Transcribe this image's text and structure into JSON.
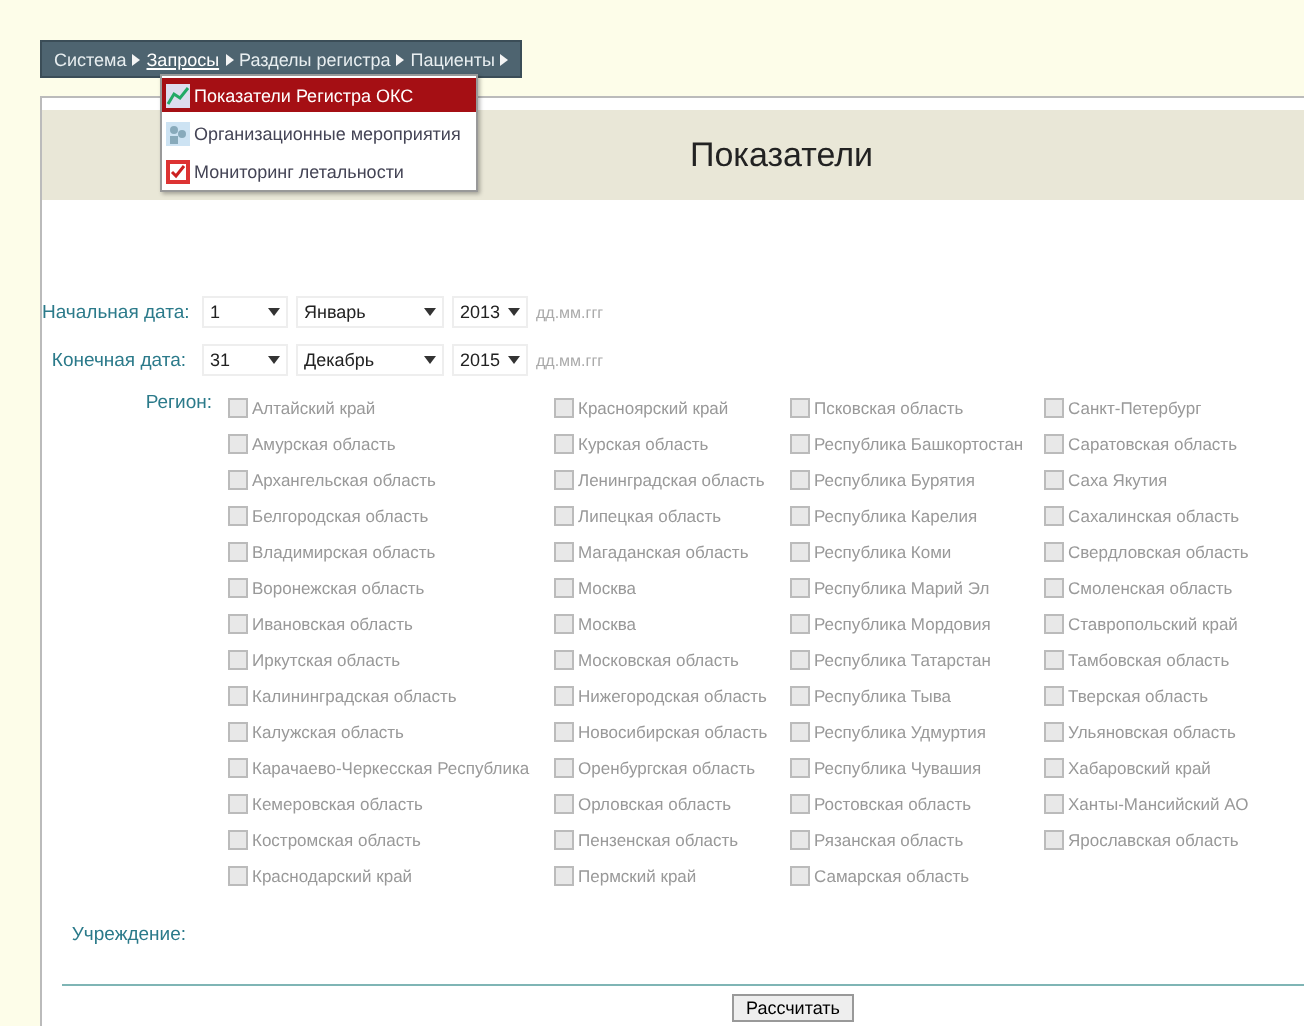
{
  "menu_bar": {
    "items": [
      {
        "label": "Система",
        "expanded": false
      },
      {
        "label": "Запросы",
        "expanded": true
      },
      {
        "label": "Разделы регистра",
        "expanded": false
      },
      {
        "label": "Пациенты",
        "expanded": false
      }
    ]
  },
  "dropdown": {
    "items": [
      {
        "label": "Показатели Регистра ОКС",
        "kind": "chart",
        "selected": true
      },
      {
        "label": "Организационные мероприятия",
        "kind": "people",
        "selected": false
      },
      {
        "label": "Мониторинг летальности",
        "kind": "checklist",
        "selected": false
      }
    ]
  },
  "page_title": "Показатели",
  "dates": [
    {
      "label": "Начальная дата:",
      "day": "1",
      "month": "Январь",
      "year": "2013",
      "hint": "дд.мм.ггг"
    },
    {
      "label": "Конечная дата:",
      "day": "31",
      "month": "Декабрь",
      "year": "2015",
      "hint": "дд.мм.ггг"
    }
  ],
  "region": {
    "label": "Регион:",
    "options": [
      {
        "label": "Алтайский край",
        "checked": false
      },
      {
        "label": "Амурская область",
        "checked": false
      },
      {
        "label": "Архангельская область",
        "checked": false
      },
      {
        "label": "Белгородская область",
        "checked": false
      },
      {
        "label": "Владимирская область",
        "checked": false
      },
      {
        "label": "Воронежская область",
        "checked": false
      },
      {
        "label": "Ивановская область",
        "checked": false
      },
      {
        "label": "Иркутская область",
        "checked": false
      },
      {
        "label": "Калининградская область",
        "checked": false
      },
      {
        "label": "Калужская область",
        "checked": false
      },
      {
        "label": "Карачаево-Черкесская Республика",
        "checked": false
      },
      {
        "label": "Кемеровская область",
        "checked": false
      },
      {
        "label": "Костромская область",
        "checked": false
      },
      {
        "label": "Краснодарский край",
        "checked": false
      },
      {
        "label": "Красноярский край",
        "checked": false
      },
      {
        "label": "Курская область",
        "checked": false
      },
      {
        "label": "Ленинградская область",
        "checked": false
      },
      {
        "label": "Липецкая область",
        "checked": false
      },
      {
        "label": "Магаданская область",
        "checked": false
      },
      {
        "label": "Москва",
        "checked": false
      },
      {
        "label": "Москва",
        "checked": false
      },
      {
        "label": "Московская область",
        "checked": false
      },
      {
        "label": "Нижегородская область",
        "checked": false
      },
      {
        "label": "Новосибирская область",
        "checked": false
      },
      {
        "label": "Оренбургская область",
        "checked": false
      },
      {
        "label": "Орловская область",
        "checked": false
      },
      {
        "label": "Пензенская область",
        "checked": false
      },
      {
        "label": "Пермский край",
        "checked": false
      },
      {
        "label": "Псковская область",
        "checked": false
      },
      {
        "label": "Республика Башкортостан",
        "checked": false
      },
      {
        "label": "Республика Бурятия",
        "checked": false
      },
      {
        "label": "Республика Карелия",
        "checked": false
      },
      {
        "label": "Республика Коми",
        "checked": false
      },
      {
        "label": "Республика Марий Эл",
        "checked": false
      },
      {
        "label": "Республика Мордовия",
        "checked": false
      },
      {
        "label": "Республика Татарстан",
        "checked": false
      },
      {
        "label": "Республика Тыва",
        "checked": false
      },
      {
        "label": "Республика Удмуртия",
        "checked": false
      },
      {
        "label": "Республика Чувашия",
        "checked": false
      },
      {
        "label": "Ростовская область",
        "checked": false
      },
      {
        "label": "Рязанская область",
        "checked": false
      },
      {
        "label": "Самарская область",
        "checked": false
      },
      {
        "label": "Санкт-Петербург",
        "checked": false
      },
      {
        "label": "Саратовская область",
        "checked": false
      },
      {
        "label": "Саха Якутия",
        "checked": false
      },
      {
        "label": "Сахалинская область",
        "checked": false
      },
      {
        "label": "Свердловская область",
        "checked": false
      },
      {
        "label": "Смоленская область",
        "checked": false
      },
      {
        "label": "Ставропольский край",
        "checked": false
      },
      {
        "label": "Тамбовская область",
        "checked": false
      },
      {
        "label": "Тверская область",
        "checked": false
      },
      {
        "label": "Ульяновская область",
        "checked": false
      },
      {
        "label": "Хабаровский край",
        "checked": false
      },
      {
        "label": "Ханты-Мансийский АО",
        "checked": false
      },
      {
        "label": "Ярославская область",
        "checked": false
      }
    ]
  },
  "institution": {
    "label": "Учреждение:"
  },
  "calculate_button": "Рассчитать"
}
